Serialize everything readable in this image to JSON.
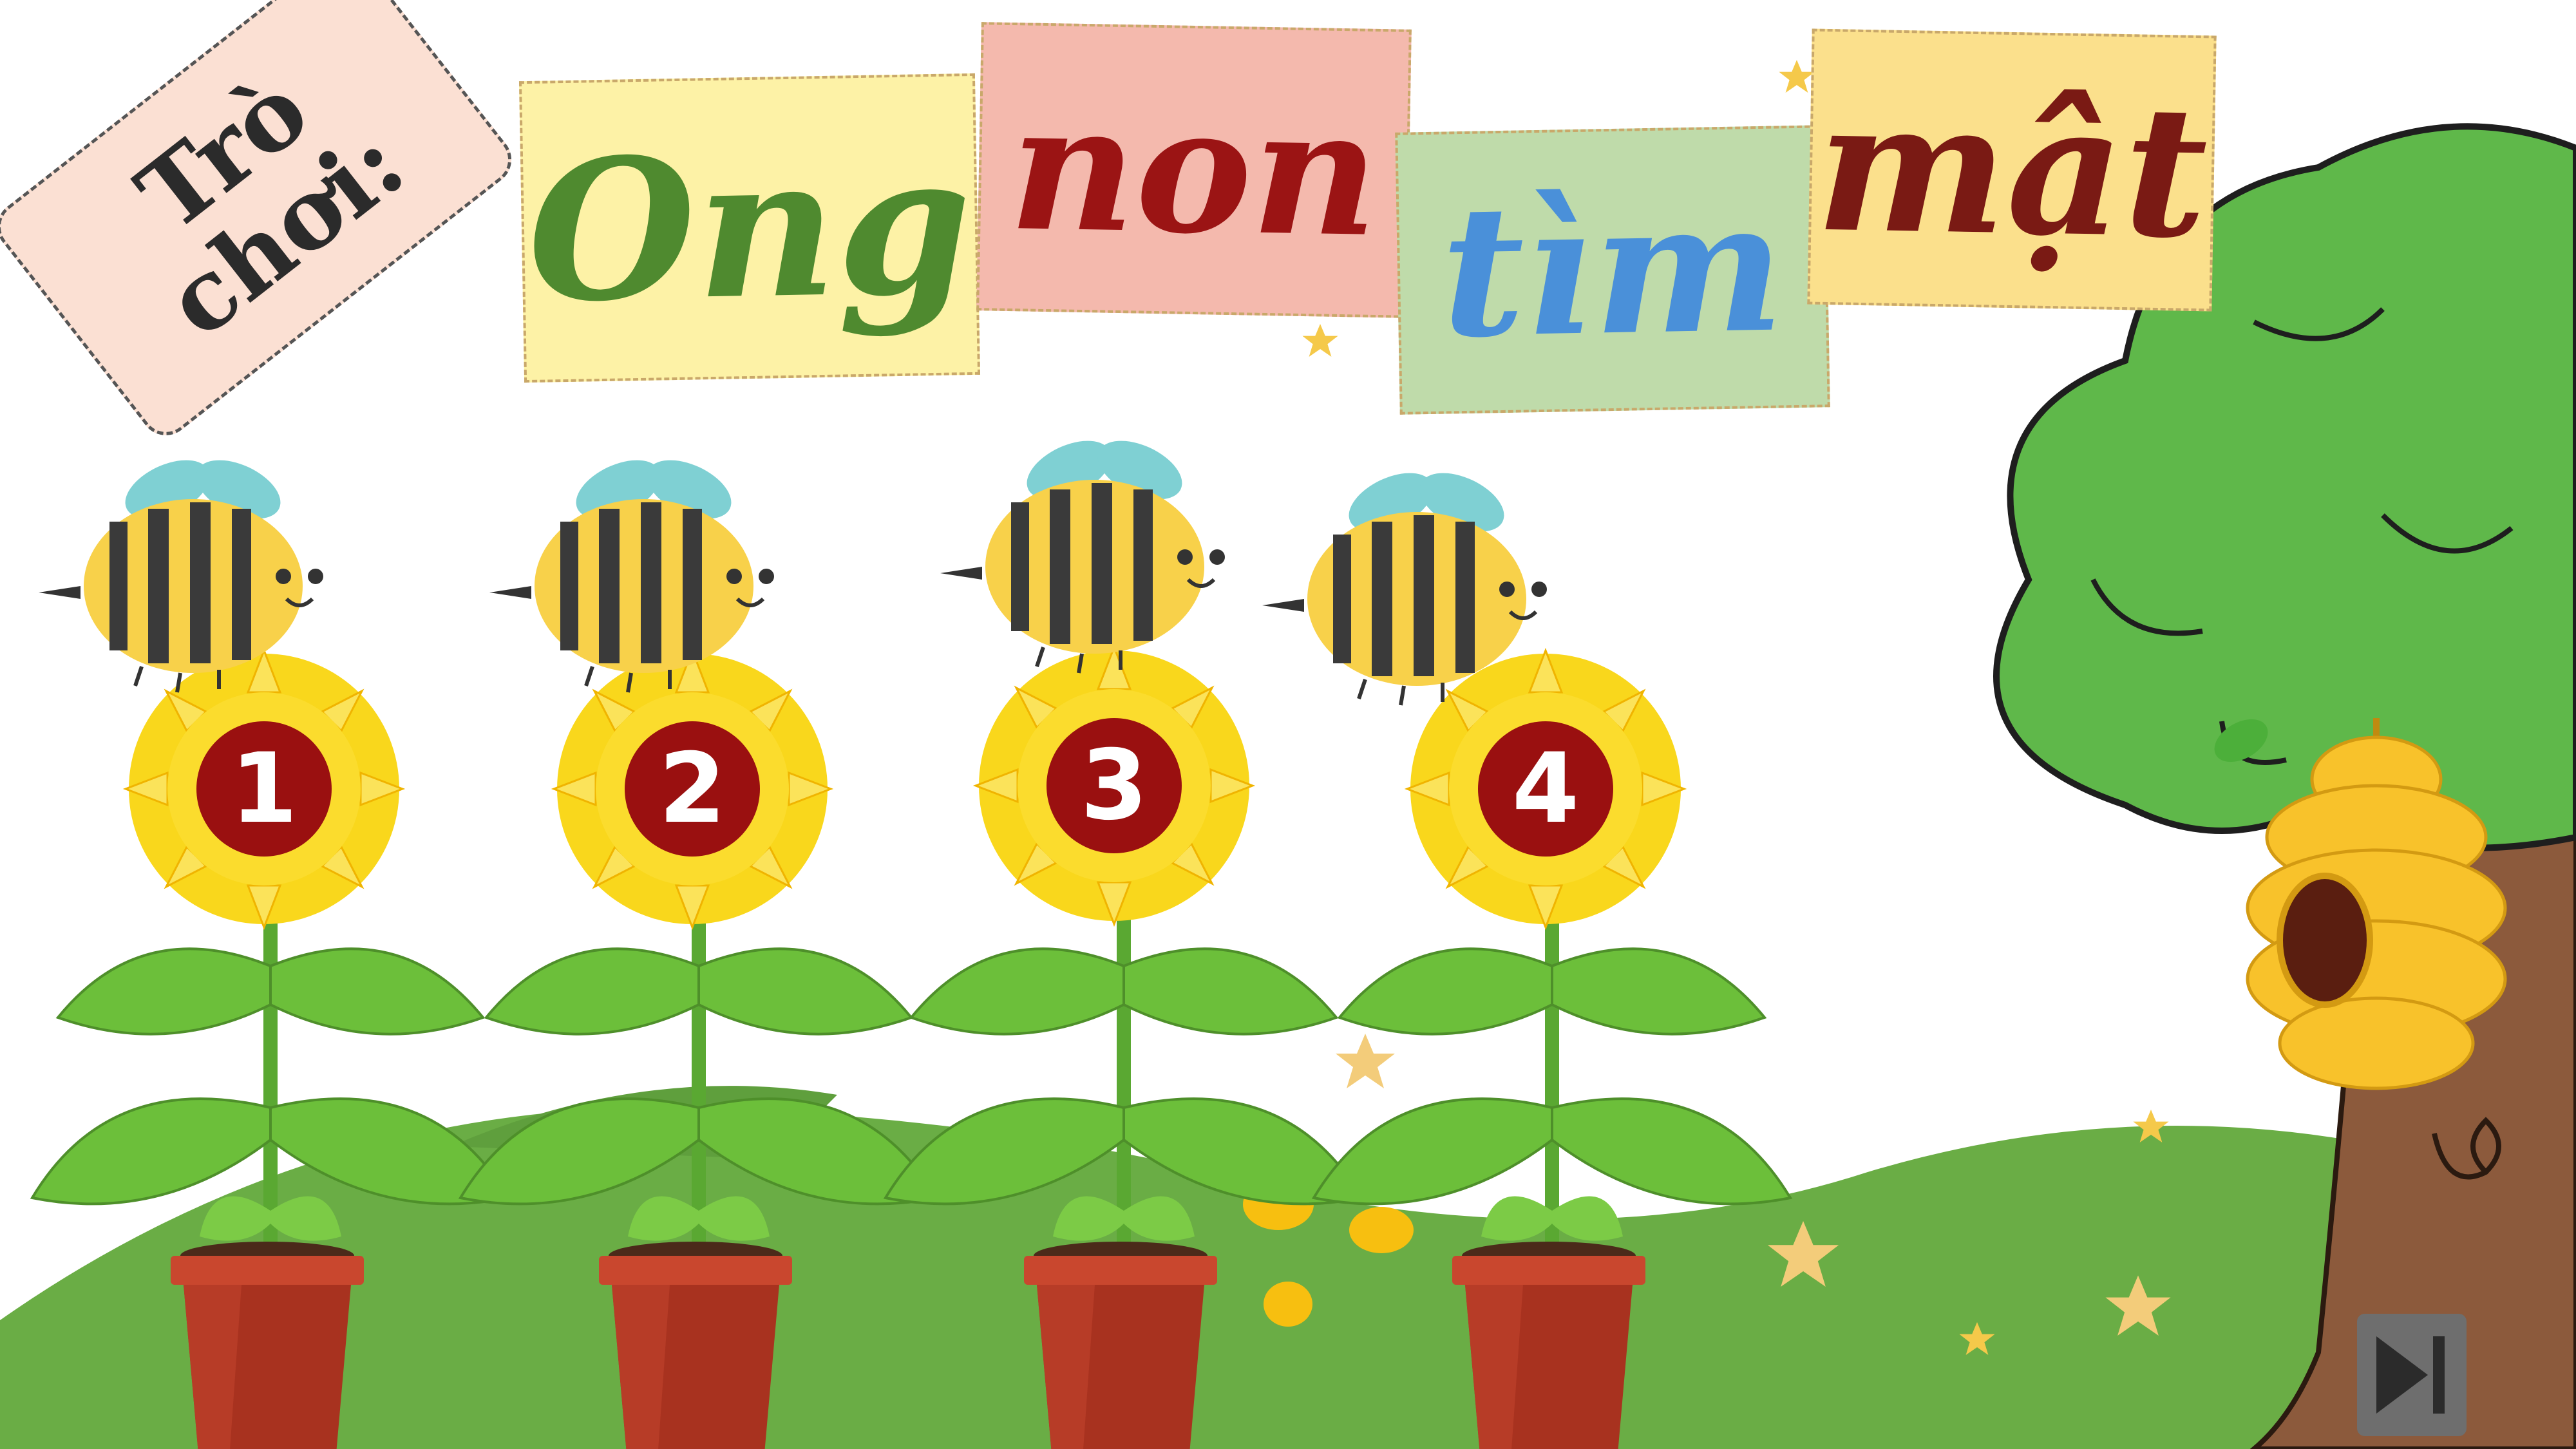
{
  "game_label": {
    "line1": "Trò",
    "line2": "chơi:"
  },
  "title_words": [
    {
      "text": "Ong",
      "color": "#4f8a2f",
      "card": "#fdf2a6"
    },
    {
      "text": "non",
      "color": "#9b1414",
      "card": "#f4b9ad"
    },
    {
      "text": "tìm",
      "color": "#4a90d9",
      "card": "#bfdbaa"
    },
    {
      "text": "mật",
      "color": "#7a1a14",
      "card": "#fbe08c"
    }
  ],
  "flowers": [
    {
      "number": "1"
    },
    {
      "number": "2"
    },
    {
      "number": "3"
    },
    {
      "number": "4"
    }
  ],
  "colors": {
    "grass": "#6aad45",
    "leaf": "#6cbf3a",
    "petal": "#f9d71c",
    "pot": "#b8402b",
    "number_badge": "#9a1010",
    "tree_foliage": "#5fb84a",
    "trunk": "#8c5a3c",
    "hive": "#f8c22b"
  },
  "icons": {
    "skip": "skip-forward-icon"
  }
}
